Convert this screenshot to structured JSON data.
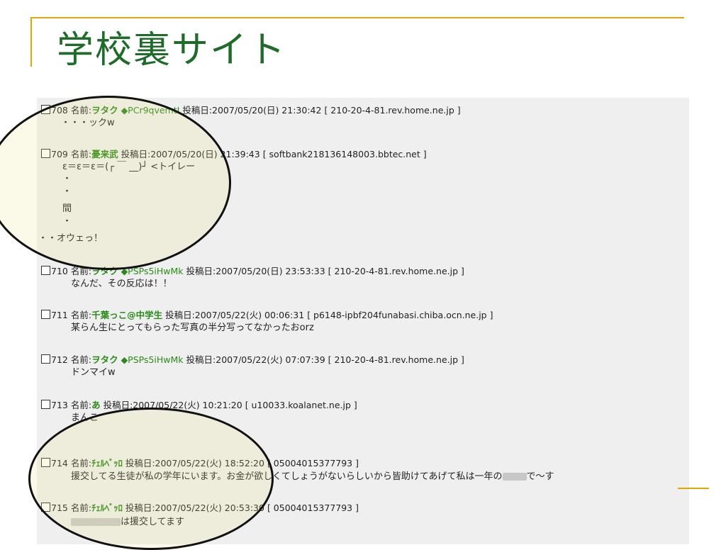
{
  "slide": {
    "title": "学校裏サイト"
  },
  "posts": [
    {
      "num": "708",
      "name_label": "名前:",
      "name": "ヲタク",
      "trip": "◆PCr9qvemtI",
      "date_label": "投稿日:",
      "date": "2007/05/20(日) 21:30:42",
      "host": "[ 210-20-4-81.rev.home.ne.jp ]",
      "body": "・・・ックw"
    },
    {
      "num": "709",
      "name_label": "名前:",
      "name": "憂来武",
      "trip": "",
      "date_label": "投稿日:",
      "date": "2007/05/20(日) 21:39:43",
      "host": "[ softbank218136148003.bbtec.net ]",
      "body": "ε＝ε＝ε＝(┌ ￣ __)┘ <トイレー",
      "extra": [
        "・",
        "・",
        "間",
        "・",
        "・・オウェっ！"
      ]
    },
    {
      "num": "710",
      "name_label": "名前:",
      "name": "ヲタク",
      "trip": "◆PSPs5iHwMk",
      "date_label": "投稿日:",
      "date": "2007/05/20(日) 23:53:33",
      "host": "[ 210-20-4-81.rev.home.ne.jp ]",
      "body": "なんだ、その反応は！！"
    },
    {
      "num": "711",
      "name_label": "名前:",
      "name": "千葉っこ@中学生",
      "trip": "",
      "date_label": "投稿日:",
      "date": "2007/05/22(火) 00:06:31",
      "host": "[ p6148-ipbf204funabasi.chiba.ocn.ne.jp ]",
      "body": "某らん生にとってもらった写真の半分写ってなかったおorz"
    },
    {
      "num": "712",
      "name_label": "名前:",
      "name": "ヲタク",
      "trip": "◆PSPs5iHwMk",
      "date_label": "投稿日:",
      "date": "2007/05/22(火) 07:07:39",
      "host": "[ 210-20-4-81.rev.home.ne.jp ]",
      "body": "ドンマイw"
    },
    {
      "num": "713",
      "name_label": "名前:",
      "name": "あ",
      "trip": "",
      "date_label": "投稿日:",
      "date": "2007/05/22(火) 10:21:20",
      "host": "[ u10033.koalanet.ne.jp ]",
      "body": "まんこ"
    },
    {
      "num": "714",
      "name_label": "名前:",
      "name": "ﾁｪﾙﾍﾞｯﾛ",
      "trip": "",
      "date_label": "投稿日:",
      "date": "2007/05/22(火) 18:52:20",
      "host": "[ 05004015377793 ]",
      "body_a": "援交してる生徒が私の学年にいます。お金が欲しくてしょうがないらしいから皆助けてあげて私は一年の",
      "body_b": "で〜す"
    },
    {
      "num": "715",
      "name_label": "名前:",
      "name": "ﾁｪﾙﾍﾞｯﾛ",
      "trip": "",
      "date_label": "投稿日:",
      "date": "2007/05/22(火) 20:53:30",
      "host": "[ 05004015377793 ]",
      "body": "は援交してます"
    }
  ]
}
